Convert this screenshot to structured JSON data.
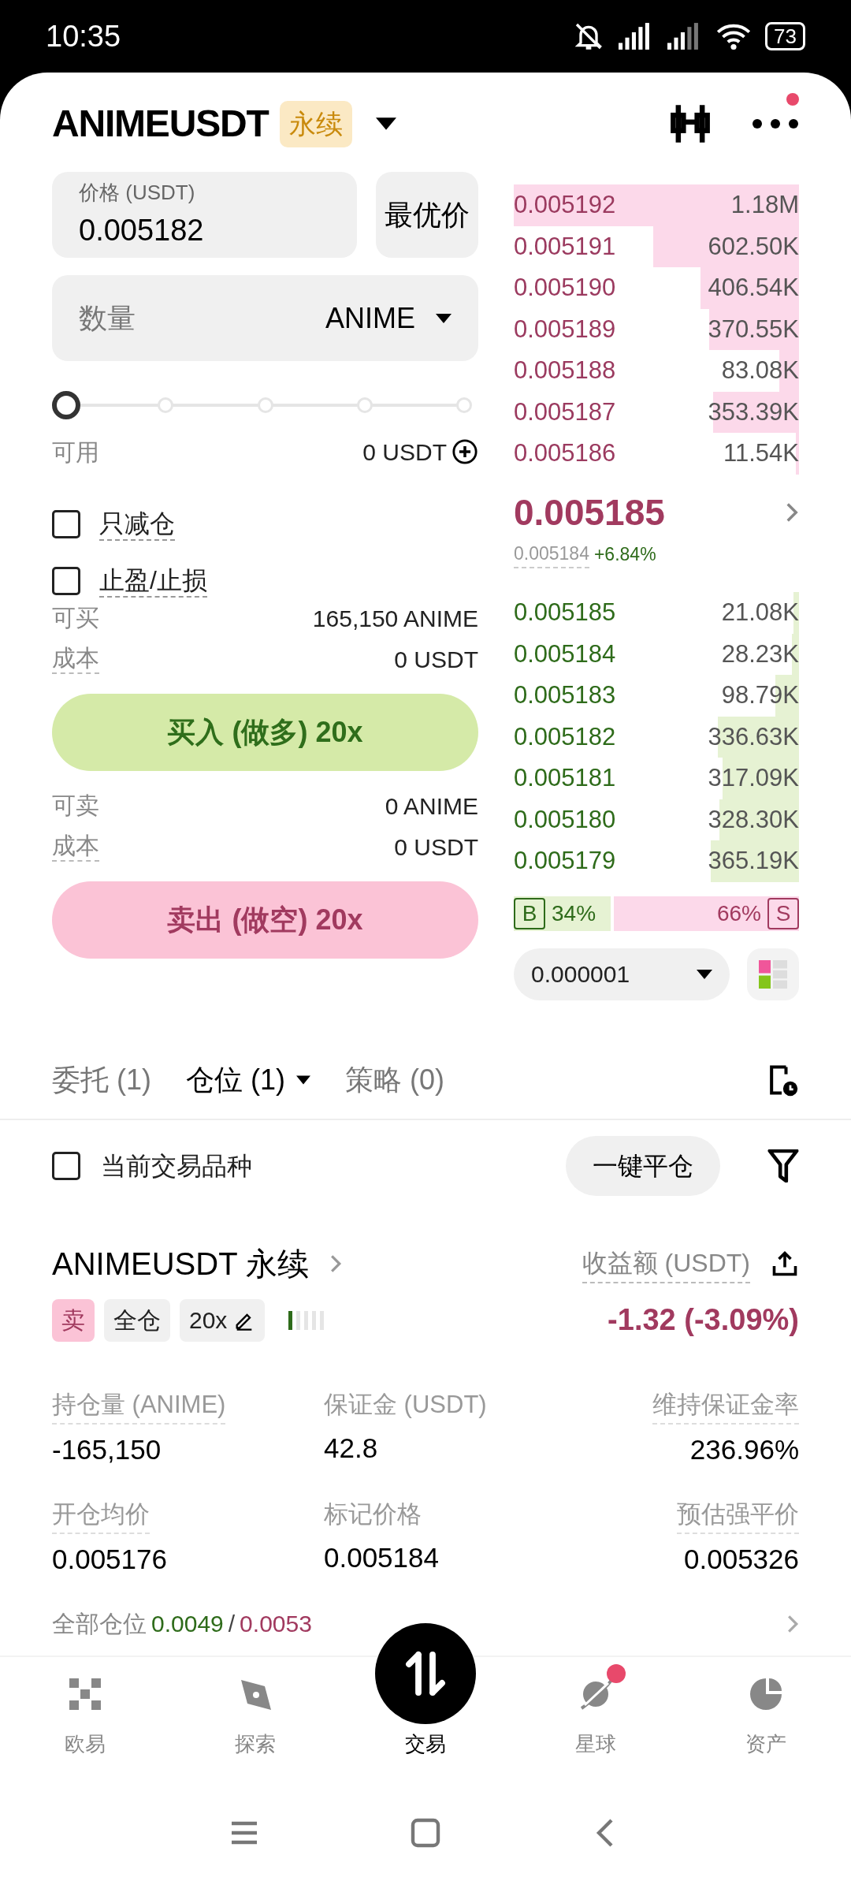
{
  "status_bar": {
    "time": "10:35",
    "battery": "73"
  },
  "header": {
    "symbol": "ANIMEUSDT",
    "badge": "永续",
    "more_notification": true
  },
  "order_form": {
    "price_label": "价格 (USDT)",
    "price_value": "0.005182",
    "best_price_button": "最优价",
    "quantity_placeholder": "数量",
    "quantity_unit": "ANIME",
    "slider": {
      "level": 0
    },
    "available_label": "可用",
    "available_value": "0 USDT",
    "options": [
      {
        "label": "只减仓",
        "checked": false
      },
      {
        "label": "止盈/止损",
        "checked": false
      }
    ],
    "buy_info": [
      {
        "label": "可买",
        "value": "165,150 ANIME"
      },
      {
        "label": "成本",
        "value": "0 USDT"
      }
    ],
    "buy_button": "买入 (做多) 20x",
    "sell_info": [
      {
        "label": "可卖",
        "value": "0 ANIME"
      },
      {
        "label": "成本",
        "value": "0 USDT"
      }
    ],
    "sell_button": "卖出 (做空) 20x"
  },
  "order_book": {
    "asks": [
      {
        "price": "0.005192",
        "amount": "1.18M",
        "level": 1.0
      },
      {
        "price": "0.005191",
        "amount": "602.50K",
        "level": 0.51
      },
      {
        "price": "0.005190",
        "amount": "406.54K",
        "level": 0.345
      },
      {
        "price": "0.005189",
        "amount": "370.55K",
        "level": 0.314
      },
      {
        "price": "0.005188",
        "amount": "83.08K",
        "level": 0.07
      },
      {
        "price": "0.005187",
        "amount": "353.39K",
        "level": 0.3
      },
      {
        "price": "0.005186",
        "amount": "11.54K",
        "level": 0.01
      }
    ],
    "last_price": "0.005185",
    "mark_price": "0.005184",
    "change": "+6.84%",
    "bids": [
      {
        "price": "0.005185",
        "amount": "21.08K",
        "level": 0.018
      },
      {
        "price": "0.005184",
        "amount": "28.23K",
        "level": 0.024
      },
      {
        "price": "0.005183",
        "amount": "98.79K",
        "level": 0.084
      },
      {
        "price": "0.005182",
        "amount": "336.63K",
        "level": 0.285
      },
      {
        "price": "0.005181",
        "amount": "317.09K",
        "level": 0.269
      },
      {
        "price": "0.005180",
        "amount": "328.30K",
        "level": 0.278
      },
      {
        "price": "0.005179",
        "amount": "365.19K",
        "level": 0.31
      }
    ],
    "ratio": {
      "buy_letter": "B",
      "buy_percent": "34%",
      "sell_percent": "66%",
      "sell_letter": "S",
      "level": 0.34
    },
    "precision": "0.000001"
  },
  "tabs": [
    {
      "label": "委托 (1)",
      "selected": false,
      "dropdown": false
    },
    {
      "label": "仓位 (1)",
      "selected": true,
      "dropdown": true
    },
    {
      "label": "策略 (0)",
      "selected": false,
      "dropdown": false
    }
  ],
  "filter": {
    "label": "当前交易品种",
    "checked": false,
    "close_all_button": "一键平仓"
  },
  "position": {
    "title": "ANIMEUSDT 永续",
    "pnl_label": "收益额 (USDT)",
    "pnl_value": "-1.32 (-3.09%)",
    "tags": [
      {
        "label": "卖",
        "kind": "side"
      },
      {
        "label": "全仓",
        "kind": "plain"
      },
      {
        "label": "20x",
        "kind": "leverage"
      }
    ],
    "stats": [
      {
        "label": "持仓量 (ANIME)",
        "value": "-165,150"
      },
      {
        "label": "保证金 (USDT)",
        "value": "42.8"
      },
      {
        "label": "维持保证金率",
        "value": "236.96%"
      },
      {
        "label": "开仓均价",
        "value": "0.005176"
      },
      {
        "label": "标记价格",
        "value": "0.005184"
      },
      {
        "label": "预估强平价",
        "value": "0.005326"
      }
    ],
    "summary": {
      "label": "全部仓位",
      "long": "0.0049",
      "separator": "/",
      "short": "0.0053"
    }
  },
  "bottom_nav": [
    {
      "label": "欧易",
      "kind": "grid",
      "selected": false,
      "badge": false
    },
    {
      "label": "探索",
      "kind": "compass",
      "selected": false,
      "badge": false
    },
    {
      "label": "交易",
      "kind": "trade",
      "selected": true,
      "badge": false
    },
    {
      "label": "星球",
      "kind": "planet",
      "selected": false,
      "badge": true
    },
    {
      "label": "资产",
      "kind": "pie",
      "selected": false,
      "badge": false
    }
  ]
}
